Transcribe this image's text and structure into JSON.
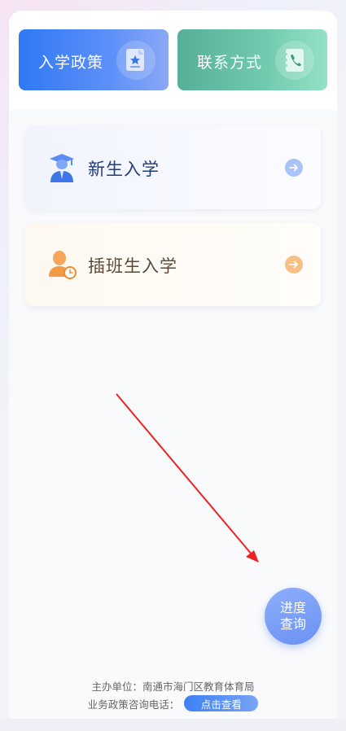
{
  "top_buttons": {
    "policy_label": "入学政策",
    "contact_label": "联系方式"
  },
  "cards": {
    "new_label": "新生入学",
    "transfer_label": "插班生入学"
  },
  "fab": {
    "line1": "进度",
    "line2": "查询"
  },
  "footer": {
    "organizer": "主办单位：南通市海门区教育体育局",
    "hotline_label": "业务政策咨询电话：",
    "view_button": "点击查看"
  },
  "icons": {
    "policy": "document-star-icon",
    "contact": "phone-book-icon",
    "new_student": "graduate-icon",
    "transfer_student": "user-clock-icon",
    "card_arrow": "arrow-right-circle-icon"
  },
  "colors": {
    "primary_blue": "#2f79f6",
    "green": "#56b097",
    "orange_arrow": "#f8bf85",
    "annotation_red": "#ee2222"
  }
}
